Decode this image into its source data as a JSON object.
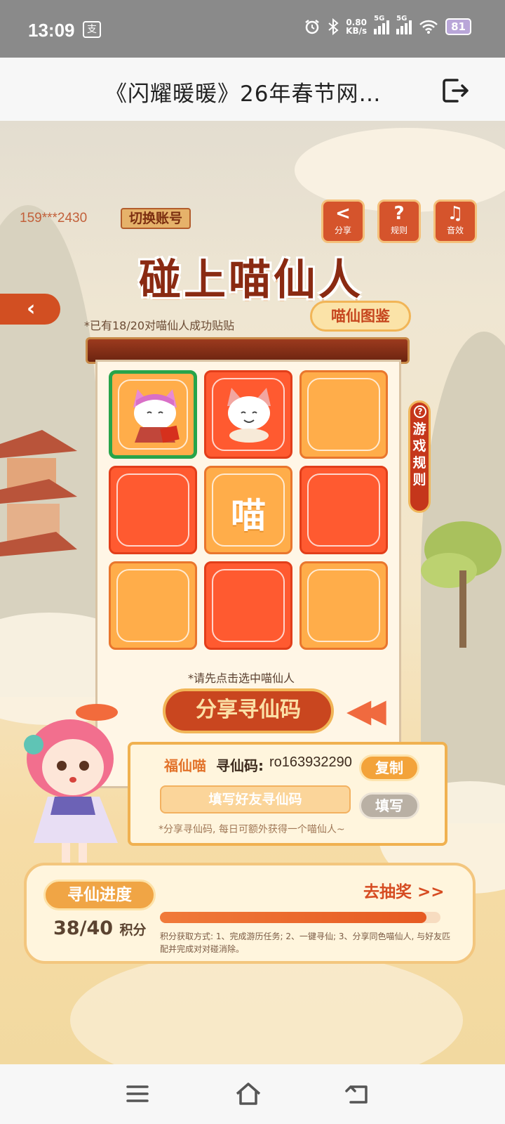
{
  "status_bar": {
    "time": "13:09",
    "app_icon_text": "支",
    "net_speed_value": "0.80",
    "net_speed_unit": "KB/s",
    "sim1": "5G",
    "sim2": "5G",
    "battery": "81",
    "icons": [
      "alarm-icon",
      "bluetooth-icon",
      "signal-icon",
      "wifi-icon",
      "battery-icon"
    ]
  },
  "title_bar": {
    "title": "《闪耀暖暖》26年春节网…",
    "exit_icon": "exit-icon"
  },
  "header": {
    "account": "159***2430",
    "switch_account": "切换账号",
    "buttons": [
      {
        "icon": "share-icon",
        "glyph": "<",
        "label": "分享"
      },
      {
        "icon": "help-icon",
        "glyph": "?",
        "label": "规则"
      },
      {
        "icon": "music-icon",
        "glyph": "♫",
        "label": "音效"
      }
    ]
  },
  "main": {
    "title": "碰上喵仙人",
    "paired_note": "*已有18/20对喵仙人成功贴贴",
    "atlas_button": "喵仙图鉴",
    "side_rules": "游戏规则",
    "center_tile_text": "喵",
    "tiles": [
      {
        "color": "orange",
        "state": "selected",
        "content": "cat"
      },
      {
        "color": "red",
        "state": "revealed",
        "content": "cat"
      },
      {
        "color": "orange",
        "state": "hidden",
        "content": ""
      },
      {
        "color": "red",
        "state": "hidden",
        "content": ""
      },
      {
        "color": "orange",
        "state": "center",
        "content": "miao"
      },
      {
        "color": "red",
        "state": "hidden",
        "content": ""
      },
      {
        "color": "orange",
        "state": "hidden",
        "content": ""
      },
      {
        "color": "red",
        "state": "hidden",
        "content": ""
      },
      {
        "color": "orange",
        "state": "hidden",
        "content": ""
      }
    ],
    "select_hint": "*请先点击选中喵仙人",
    "share_code_button": "分享寻仙码"
  },
  "code_panel": {
    "name": "福仙喵",
    "label": "寻仙码:",
    "value": "ro163932290",
    "copy_button": "复制",
    "input_placeholder": "填写好友寻仙码",
    "fill_button": "填写",
    "note": "*分享寻仙码, 每日可额外获得一个喵仙人~"
  },
  "progress": {
    "label": "寻仙进度",
    "current": "38",
    "separator": "/",
    "total": "40",
    "unit": "积分",
    "fraction": 0.95,
    "lottery_link": "去抽奖 >>",
    "note": "积分获取方式: 1、完成游历任务; 2、一键寻仙; 3、分享同色喵仙人, 与好友匹配并完成对对碰消除。"
  },
  "nav_bar": {
    "icons": [
      "menu-icon",
      "home-icon",
      "back-icon"
    ]
  },
  "colors": {
    "accent_red": "#d24f22",
    "tile_orange": "#ffad4a",
    "tile_red": "#ff5a30",
    "selected_green": "#27a44a",
    "title_brown": "#8a2a12"
  }
}
